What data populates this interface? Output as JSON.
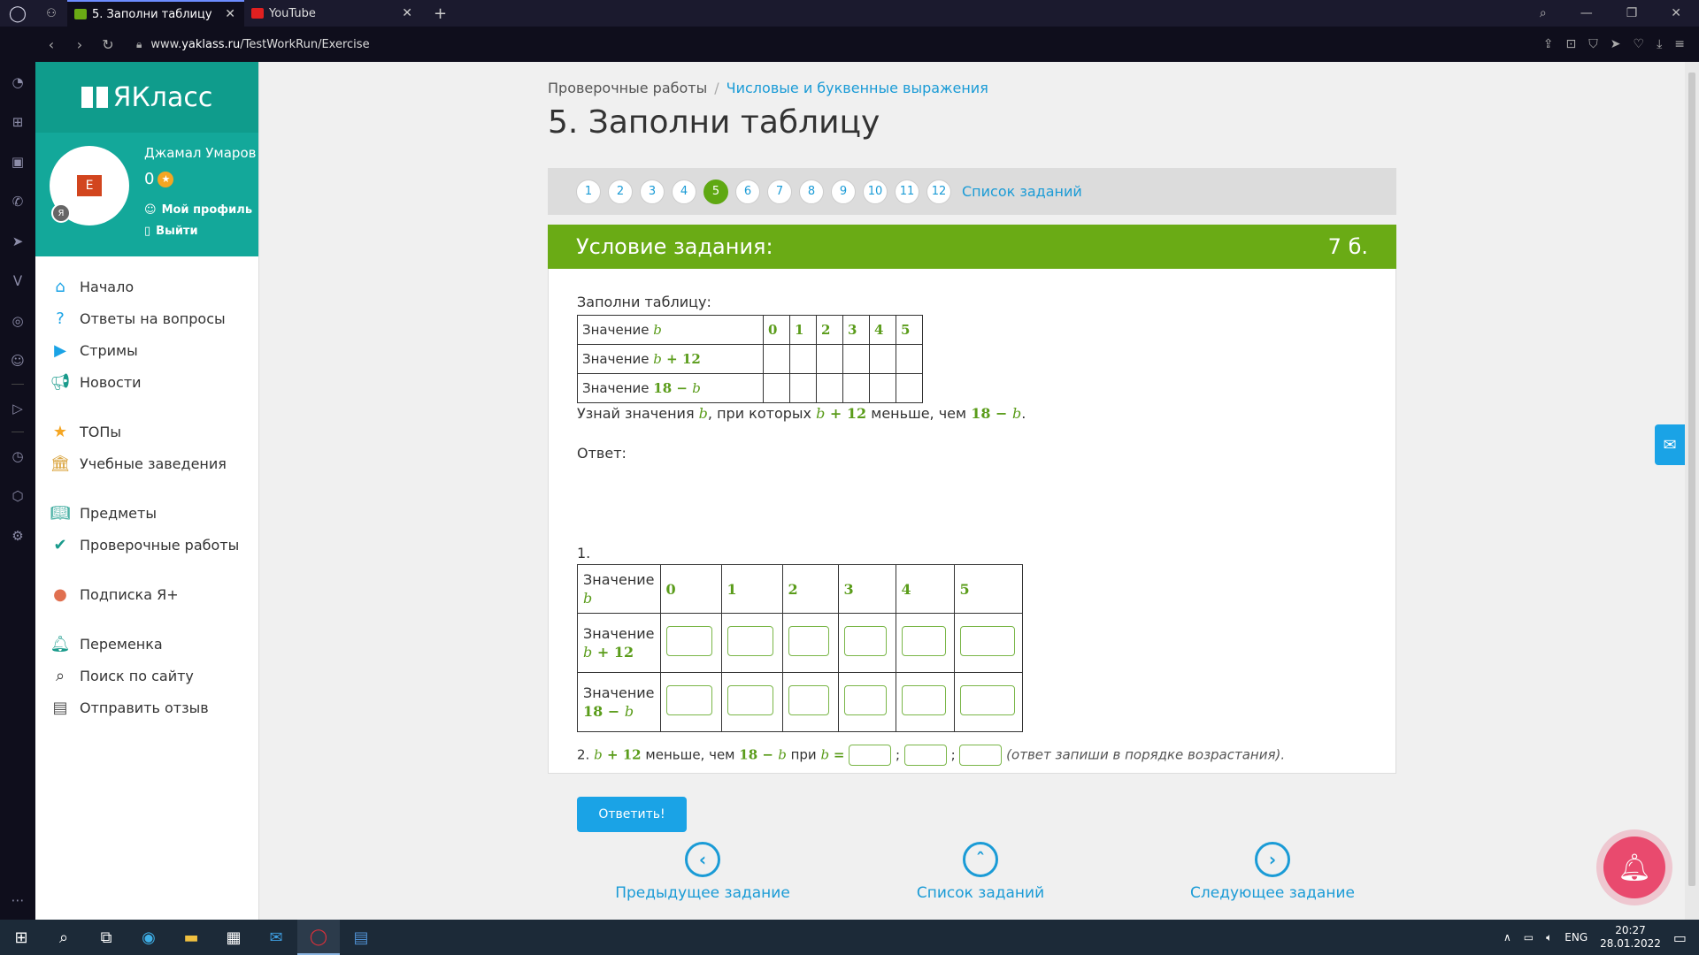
{
  "browser": {
    "tabs": [
      {
        "title": "5. Заполни таблицу",
        "active": true
      },
      {
        "title": "YouTube",
        "active": false
      }
    ],
    "url_prefix": "www.",
    "url_domain": "yaklass.ru",
    "url_path": "/TestWorkRun/Exercise"
  },
  "sidebar": {
    "logo": "ЯКласс",
    "user_name": "Джамал Умаров",
    "points": "0",
    "avatar_letter": "E",
    "profile_link": "Мой профиль",
    "logout_link": "Выйти",
    "menu": [
      {
        "label": "Начало",
        "icon": "home-icon"
      },
      {
        "label": "Ответы на вопросы",
        "icon": "question-icon"
      },
      {
        "label": "Стримы",
        "icon": "play-icon"
      },
      {
        "label": "Новости",
        "icon": "megaphone-icon"
      },
      {
        "label": "ТОПы",
        "icon": "star-icon"
      },
      {
        "label": "Учебные заведения",
        "icon": "school-icon"
      },
      {
        "label": "Предметы",
        "icon": "book-icon"
      },
      {
        "label": "Проверочные работы",
        "icon": "check-icon"
      },
      {
        "label": "Подписка Я+",
        "icon": "subscription-icon"
      },
      {
        "label": "Переменка",
        "icon": "bell-icon"
      },
      {
        "label": "Поиск по сайту",
        "icon": "search-icon"
      },
      {
        "label": "Отправить отзыв",
        "icon": "feedback-icon"
      }
    ]
  },
  "breadcrumb": {
    "root": "Проверочные работы",
    "current": "Числовые и буквенные выражения"
  },
  "title": "5. Заполни таблицу",
  "pager": {
    "pages": [
      "1",
      "2",
      "3",
      "4",
      "5",
      "6",
      "7",
      "8",
      "9",
      "10",
      "11",
      "12"
    ],
    "current": "5",
    "list_label": "Список заданий"
  },
  "task": {
    "header": "Условие задания:",
    "points": "7 б.",
    "intro": "Заполни таблицу:",
    "row_label_prefix": "Значение",
    "var": "b",
    "expr1_a": "b",
    "expr1_op": "+",
    "expr1_b": "12",
    "expr2_a": "18",
    "expr2_op": "−",
    "expr2_b": "b",
    "values": [
      "0",
      "1",
      "2",
      "3",
      "4",
      "5"
    ],
    "question_a": "Узнай значения",
    "question_b": ", при которых",
    "question_c": "меньше, чем",
    "answer_label": "Ответ:",
    "item1": "1.",
    "item2": "2.",
    "item2_text_a": "меньше, чем",
    "item2_text_b": "при",
    "item2_eq": "=",
    "item2_note": "(ответ запиши в порядке возрастания).",
    "submit": "Ответить!"
  },
  "bottom_nav": {
    "prev": "Предыдущее задание",
    "list": "Список заданий",
    "next": "Следующее задание"
  },
  "taskbar": {
    "lang": "ENG",
    "time": "20:27",
    "date": "28.01.2022"
  }
}
